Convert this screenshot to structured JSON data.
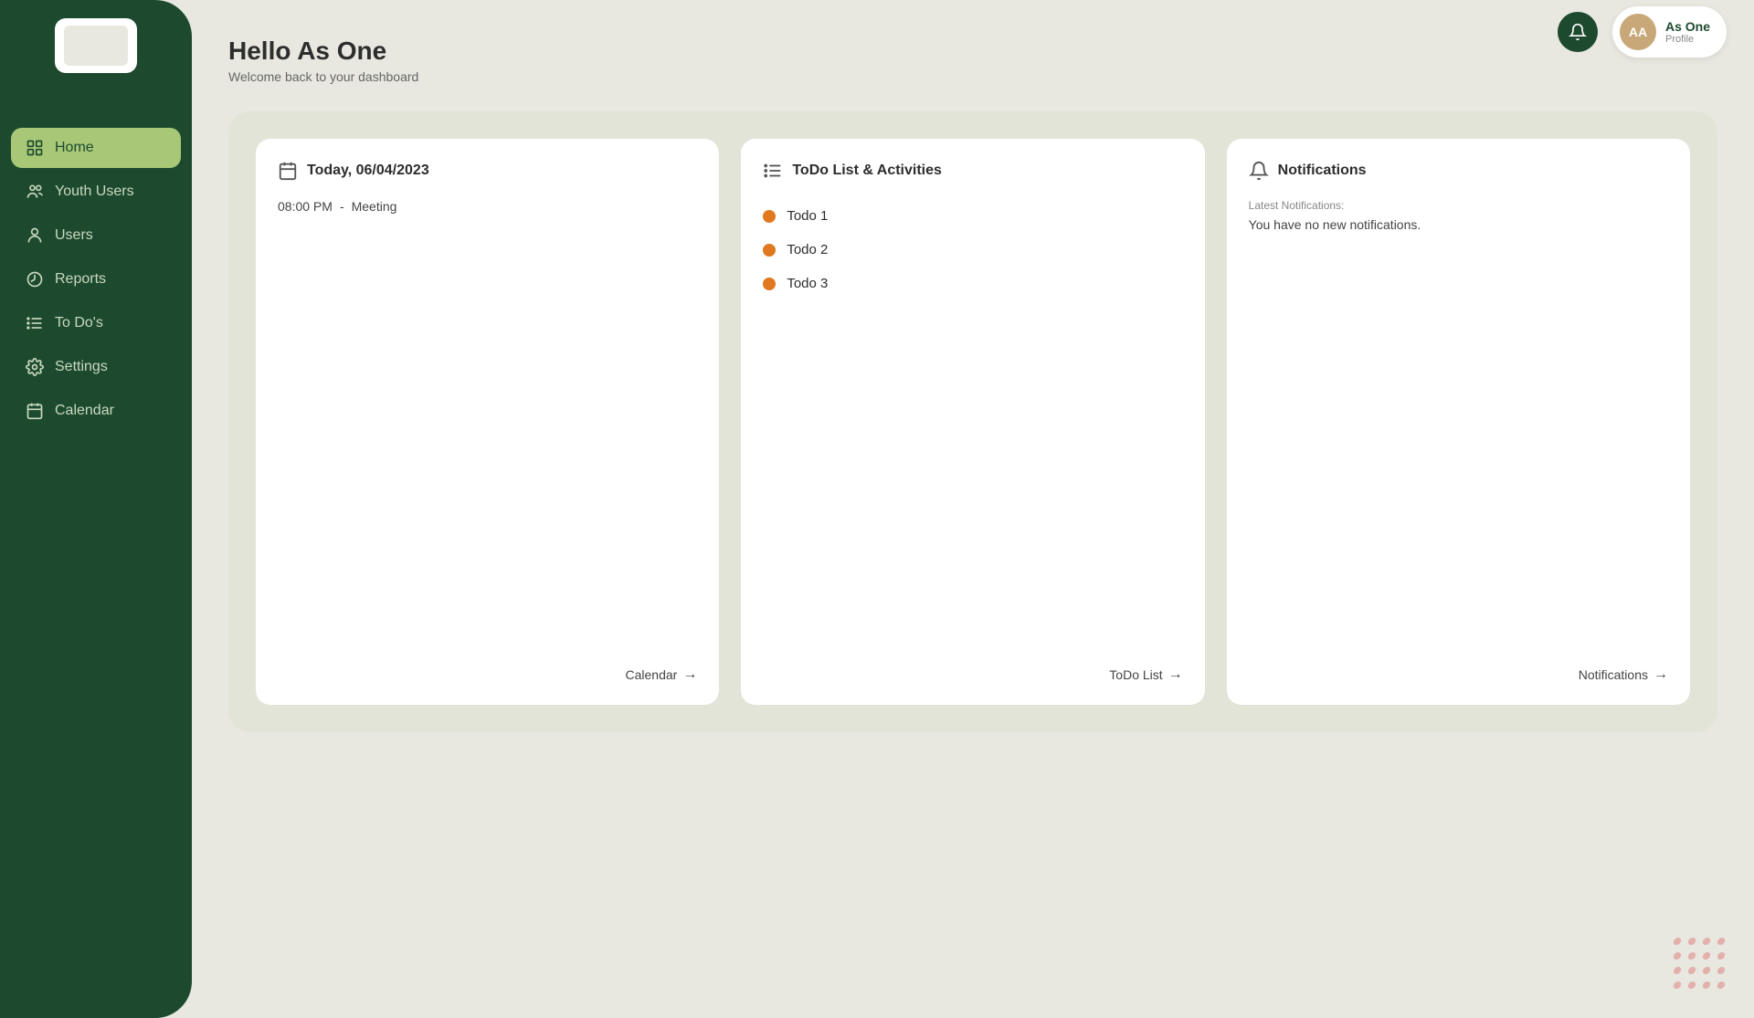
{
  "sidebar": {
    "items": [
      {
        "id": "home",
        "label": "Home",
        "icon": "home",
        "active": true
      },
      {
        "id": "youth-users",
        "label": "Youth Users",
        "icon": "user-group",
        "active": false
      },
      {
        "id": "users",
        "label": "Users",
        "icon": "users",
        "active": false
      },
      {
        "id": "reports",
        "label": "Reports",
        "icon": "reports",
        "active": false
      },
      {
        "id": "todos",
        "label": "To Do's",
        "icon": "list",
        "active": false
      },
      {
        "id": "settings",
        "label": "Settings",
        "icon": "settings",
        "active": false
      },
      {
        "id": "calendar",
        "label": "Calendar",
        "icon": "calendar",
        "active": false
      }
    ]
  },
  "header": {
    "profile_initials": "AA",
    "profile_name": "As One",
    "profile_role": "Profile"
  },
  "page": {
    "greeting": "Hello As One",
    "subtitle": "Welcome back to your dashboard"
  },
  "calendar_card": {
    "title": "Today, 06/04/2023",
    "event_time": "08:00 PM",
    "event_separator": "-",
    "event_name": "Meeting",
    "footer_link": "Calendar"
  },
  "todo_card": {
    "title": "ToDo List & Activities",
    "items": [
      {
        "label": "Todo 1"
      },
      {
        "label": "Todo 2"
      },
      {
        "label": "Todo 3"
      }
    ],
    "footer_link": "ToDo List"
  },
  "notifications_card": {
    "title": "Notifications",
    "latest_label": "Latest Notifications:",
    "empty_message": "You have no new notifications.",
    "footer_link": "Notifications"
  }
}
